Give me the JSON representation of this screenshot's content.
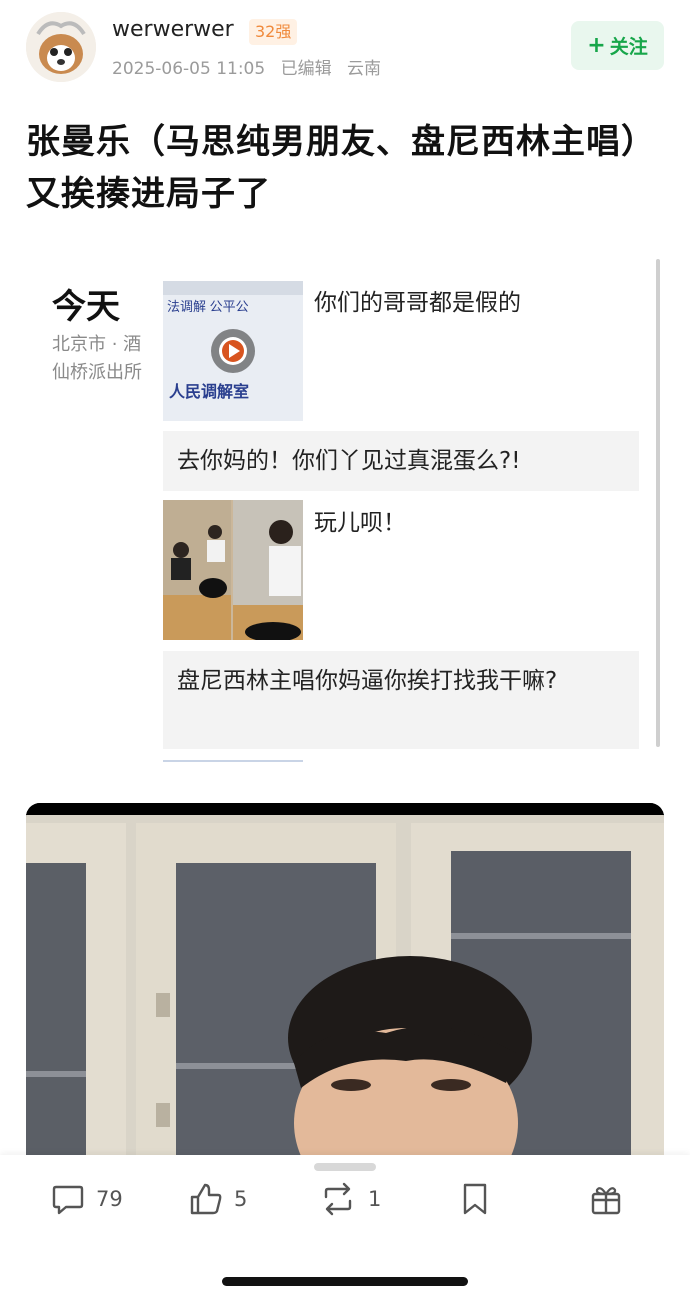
{
  "post": {
    "username": "werwerwer",
    "level_badge": "32强",
    "timestamp": "2025-06-05 11:05",
    "edited_label": "已编辑",
    "location": "云南",
    "follow_label": "关注",
    "title": "张曼乐（马思纯男朋友、盘尼西林主唱）又挨揍进局子了"
  },
  "chat": {
    "day_label": "今天",
    "place": "北京市 · 酒仙桥派出所",
    "thumb1_text_top": "法调解 公平公",
    "thumb1_text_bottom": "人民调解室",
    "messages": [
      "你们的哥哥都是假的",
      "去你妈的！你们丫见过真混蛋么?!",
      "玩儿呗！",
      "盘尼西林主唱你妈逼你挨打找我干嘛?"
    ]
  },
  "toolbar": {
    "comments": "79",
    "likes": "5",
    "reposts": "1",
    "icons": [
      "comment-icon",
      "like-icon",
      "repost-icon",
      "bookmark-icon",
      "gift-icon"
    ]
  },
  "colors": {
    "accent_green": "#17a64a",
    "badge_orange": "#f08a3c"
  }
}
